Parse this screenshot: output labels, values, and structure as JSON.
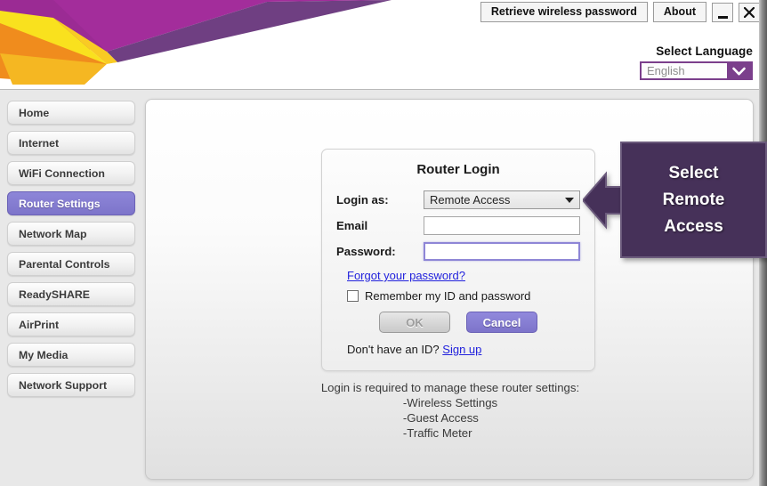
{
  "titlebar": {
    "retrieve_label": "Retrieve wireless password",
    "about_label": "About",
    "minimize_icon": "minimize-icon",
    "close_icon": "close-icon",
    "close_glyph": "✕",
    "minimize_glyph": "—"
  },
  "language": {
    "label": "Select Language",
    "selected": "English",
    "chevron_icon": "chevron-down-icon"
  },
  "sidebar": {
    "items": [
      {
        "label": "Home",
        "active": false
      },
      {
        "label": "Internet",
        "active": false
      },
      {
        "label": "WiFi Connection",
        "active": false
      },
      {
        "label": "Router Settings",
        "active": true
      },
      {
        "label": "Network Map",
        "active": false
      },
      {
        "label": "Parental Controls",
        "active": false
      },
      {
        "label": "ReadySHARE",
        "active": false
      },
      {
        "label": "AirPrint",
        "active": false
      },
      {
        "label": "My Media",
        "active": false
      },
      {
        "label": "Network Support",
        "active": false
      }
    ]
  },
  "login": {
    "title": "Router Login",
    "login_as_label": "Login as:",
    "login_as_value": "Remote Access",
    "login_as_options": [
      "Remote Access"
    ],
    "email_label": "Email",
    "email_value": "",
    "email_placeholder": "",
    "password_label": "Password:",
    "password_value": "",
    "password_placeholder": "",
    "forgot_link": "Forgot your password?",
    "remember_label": "Remember my ID and password",
    "remember_checked": false,
    "ok_label": "OK",
    "ok_disabled": true,
    "cancel_label": "Cancel",
    "signup_prefix": "Don't have an ID? ",
    "signup_link": "Sign up"
  },
  "note": {
    "line1": "Login is required to manage these router settings:",
    "line2": "-Wireless Settings",
    "line3": "-Guest Access",
    "line4": "-Traffic Meter"
  },
  "callout": {
    "line1": "Select",
    "line2": "Remote",
    "line3": "Access",
    "arrow_icon": "arrow-left-icon"
  },
  "colors": {
    "accent_purple": "#7d74ca",
    "callout_purple": "#463159",
    "logo_magenta": "#a32d9b",
    "logo_yellow": "#f9cb24",
    "logo_orange": "#f08c1d",
    "link_blue": "#2222dd"
  }
}
